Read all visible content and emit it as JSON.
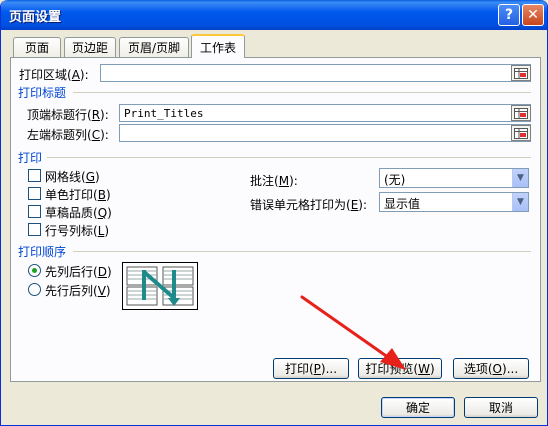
{
  "window": {
    "title": "页面设置",
    "help_glyph": "?",
    "close_glyph": "✕"
  },
  "tabs": [
    {
      "label": "页面",
      "active": false
    },
    {
      "label": "页边距",
      "active": false
    },
    {
      "label": "页眉/页脚",
      "active": false
    },
    {
      "label": "工作表",
      "active": true
    }
  ],
  "print_area": {
    "label": "打印区域",
    "key": "A",
    "value": ""
  },
  "print_titles": {
    "group_label": "打印标题",
    "rows_label": "顶端标题行",
    "rows_key": "R",
    "rows_value": "Print_Titles",
    "cols_label": "左端标题列",
    "cols_key": "C",
    "cols_value": ""
  },
  "print": {
    "group_label": "打印",
    "options": [
      {
        "label": "网格线",
        "key": "G",
        "checked": false
      },
      {
        "label": "单色打印",
        "key": "B",
        "checked": false
      },
      {
        "label": "草稿品质",
        "key": "Q",
        "checked": false
      },
      {
        "label": "行号列标",
        "key": "L",
        "checked": false
      }
    ],
    "comments_label": "批注",
    "comments_key": "M",
    "comments_value": "(无)",
    "errors_label": "错误单元格打印为",
    "errors_key": "E",
    "errors_value": "显示值"
  },
  "page_order": {
    "group_label": "打印顺序",
    "options": [
      {
        "label": "先列后行",
        "key": "D",
        "selected": true
      },
      {
        "label": "先行后列",
        "key": "V",
        "selected": false
      }
    ]
  },
  "buttons": {
    "print": {
      "label": "打印",
      "key": "P",
      "suffix": "..."
    },
    "preview": {
      "label": "打印预览",
      "key": "W"
    },
    "options": {
      "label": "选项",
      "key": "O",
      "suffix": "..."
    },
    "ok": "确定",
    "cancel": "取消"
  },
  "colors": {
    "accent_red": "#e8201a",
    "group_blue": "#0046d5"
  }
}
